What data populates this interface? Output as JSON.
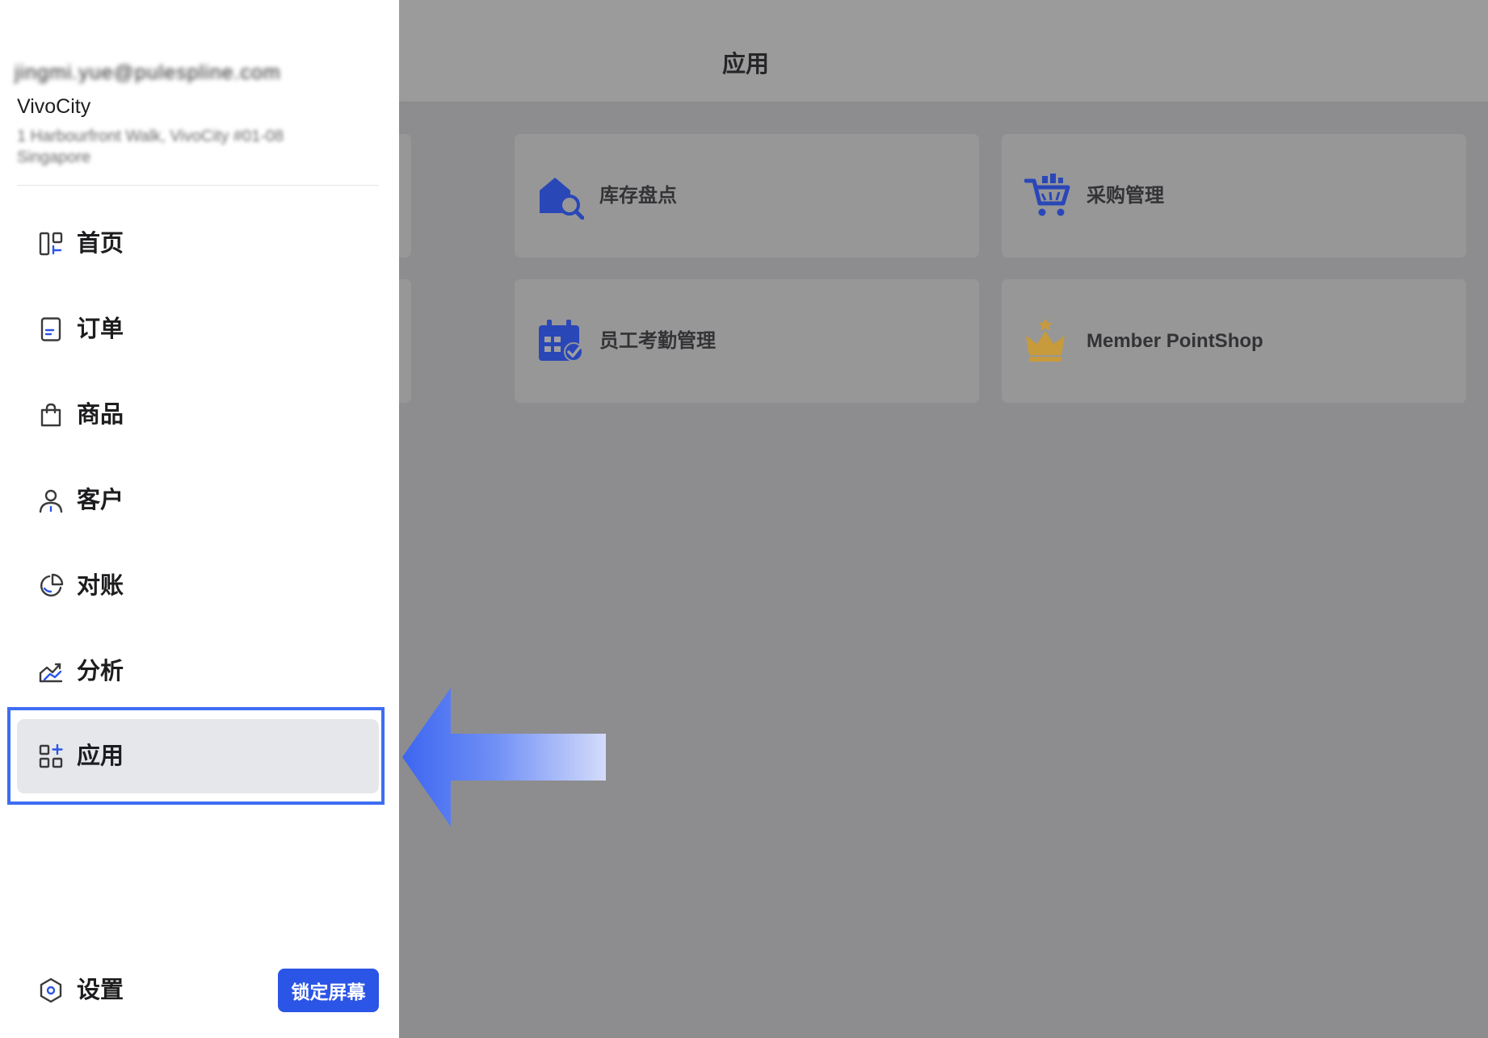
{
  "header": {
    "title": "应用"
  },
  "apps": [
    {
      "label": "库存盘点",
      "icon": "inventory-search-icon"
    },
    {
      "label": "采购管理",
      "icon": "shopping-cart-icon"
    },
    {
      "label": "员工考勤管理",
      "icon": "attendance-calendar-icon"
    },
    {
      "label": "Member PointShop",
      "icon": "crown-icon"
    }
  ],
  "sidebar": {
    "profile": {
      "email": "jingmi.yue@pulespline.com",
      "store": "VivoCity",
      "address": "1 Harbourfront Walk, VivoCity #01-08 Singapore"
    },
    "items": [
      {
        "label": "首页",
        "icon": "dashboard-icon"
      },
      {
        "label": "订单",
        "icon": "order-document-icon"
      },
      {
        "label": "商品",
        "icon": "shopping-bag-icon"
      },
      {
        "label": "客户",
        "icon": "user-icon"
      },
      {
        "label": "对账",
        "icon": "pie-chart-icon"
      },
      {
        "label": "分析",
        "icon": "trend-chart-icon"
      },
      {
        "label": "应用",
        "icon": "apps-grid-icon",
        "active": true
      }
    ],
    "settings": {
      "label": "设置",
      "icon": "settings-hex-icon"
    },
    "lock_button": "锁定屏幕"
  },
  "colors": {
    "accent": "#2b55e6",
    "highlight": "#3d6df2",
    "icon_blue": "#2a47b8",
    "crown_gold": "#c79a3c"
  }
}
